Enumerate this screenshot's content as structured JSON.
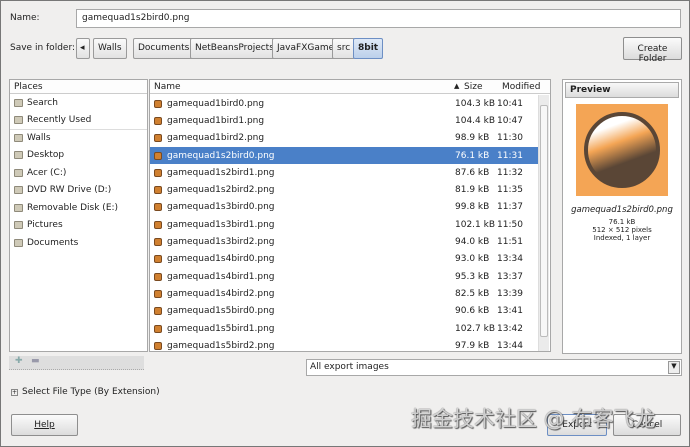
{
  "name_label": "Name:",
  "name_value": "gamequad1s2bird0.png",
  "save_in_label": "Save in folder:",
  "breadcrumbs": [
    "Walls",
    "Documents",
    "NetBeansProjects",
    "JavaFXGame",
    "src",
    "8bit"
  ],
  "create_folder": "Create Folder",
  "places_header": "Places",
  "places": [
    "Search",
    "Recently Used",
    "Walls",
    "Desktop",
    "Acer (C:)",
    "DVD RW Drive (D:)",
    "Removable Disk (E:)",
    "Pictures",
    "Documents"
  ],
  "columns": {
    "name": "Name",
    "size": "Size",
    "modified": "Modified"
  },
  "files": [
    {
      "name": "gamequad1bird0.png",
      "size": "104.3 kB",
      "modified": "10:41"
    },
    {
      "name": "gamequad1bird1.png",
      "size": "104.4 kB",
      "modified": "10:47"
    },
    {
      "name": "gamequad1bird2.png",
      "size": "98.9 kB",
      "modified": "11:30"
    },
    {
      "name": "gamequad1s2bird0.png",
      "size": "76.1 kB",
      "modified": "11:31"
    },
    {
      "name": "gamequad1s2bird1.png",
      "size": "87.6 kB",
      "modified": "11:32"
    },
    {
      "name": "gamequad1s2bird2.png",
      "size": "81.9 kB",
      "modified": "11:35"
    },
    {
      "name": "gamequad1s3bird0.png",
      "size": "99.8 kB",
      "modified": "11:37"
    },
    {
      "name": "gamequad1s3bird1.png",
      "size": "102.1 kB",
      "modified": "11:50"
    },
    {
      "name": "gamequad1s3bird2.png",
      "size": "94.0 kB",
      "modified": "11:51"
    },
    {
      "name": "gamequad1s4bird0.png",
      "size": "93.0 kB",
      "modified": "13:34"
    },
    {
      "name": "gamequad1s4bird1.png",
      "size": "95.3 kB",
      "modified": "13:37"
    },
    {
      "name": "gamequad1s4bird2.png",
      "size": "82.5 kB",
      "modified": "13:39"
    },
    {
      "name": "gamequad1s5bird0.png",
      "size": "90.6 kB",
      "modified": "13:41"
    },
    {
      "name": "gamequad1s5bird1.png",
      "size": "102.7 kB",
      "modified": "13:42"
    },
    {
      "name": "gamequad1s5bird2.png",
      "size": "97.9 kB",
      "modified": "13:44"
    }
  ],
  "selected_index": 3,
  "preview": {
    "header": "Preview",
    "filename": "gamequad1s2bird0.png",
    "size": "76.1 kB",
    "dims": "512 × 512 pixels",
    "info": "Indexed, 1 layer"
  },
  "filter": "All export images",
  "select_type": "Select File Type (By Extension)",
  "help": "Help",
  "export": "Export",
  "cancel": "Cancel",
  "watermark": "掘金技术社区 @ 布客飞龙",
  "colors": {
    "selection": "#4a80c8",
    "thumb_bg": "#f4a555"
  }
}
